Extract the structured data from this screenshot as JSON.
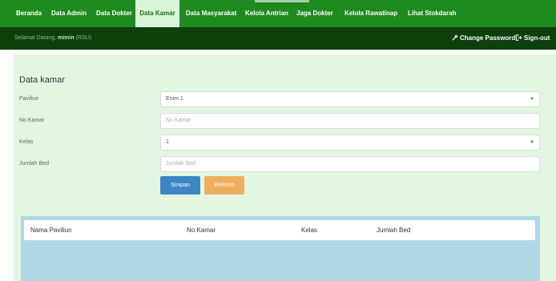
{
  "nav": {
    "items": [
      {
        "label": "Beranda"
      },
      {
        "label": "Data Admin"
      },
      {
        "label": "Data Dokter"
      },
      {
        "label": "Data Kamar"
      },
      {
        "label": "Data Masyarakat"
      },
      {
        "label": "Kelola Antrian"
      },
      {
        "label": "Jaga Dokter"
      },
      {
        "label": "Kelola Rawatinap"
      },
      {
        "label": "Lihat Stokdarah"
      }
    ],
    "active_index": 3
  },
  "subbar": {
    "welcome_prefix": "Selamat Datang,",
    "user": "mimin",
    "role": "(RSU)",
    "change_password": "Change Password",
    "sign_out": "Sign-out"
  },
  "panel": {
    "title": "Data kamar"
  },
  "form": {
    "paviliun": {
      "label": "Paviliun",
      "value": "Enim 1"
    },
    "no_kamar": {
      "label": "No Kamar",
      "placeholder": "No Kamar"
    },
    "kelas": {
      "label": "Kelas",
      "value": "1"
    },
    "jumlah_bed": {
      "label": "Jumlah Bed",
      "placeholder": "Jumlah Bed"
    },
    "save_label": "Simpan",
    "refresh_label": "Refresh"
  },
  "table": {
    "headers": [
      "Nama Paviliun",
      "No Kamar",
      "Kelas",
      "Jumlah Bed"
    ]
  },
  "colors": {
    "nav": "#1f8a1f",
    "subbar": "#0c3f0c",
    "content": "#e2f6e2",
    "save": "#3e86c6",
    "refresh": "#efae5c",
    "table": "#afd8e6"
  },
  "icons": [
    "wrench-icon",
    "sign-out-icon",
    "chevron-down-icon"
  ]
}
